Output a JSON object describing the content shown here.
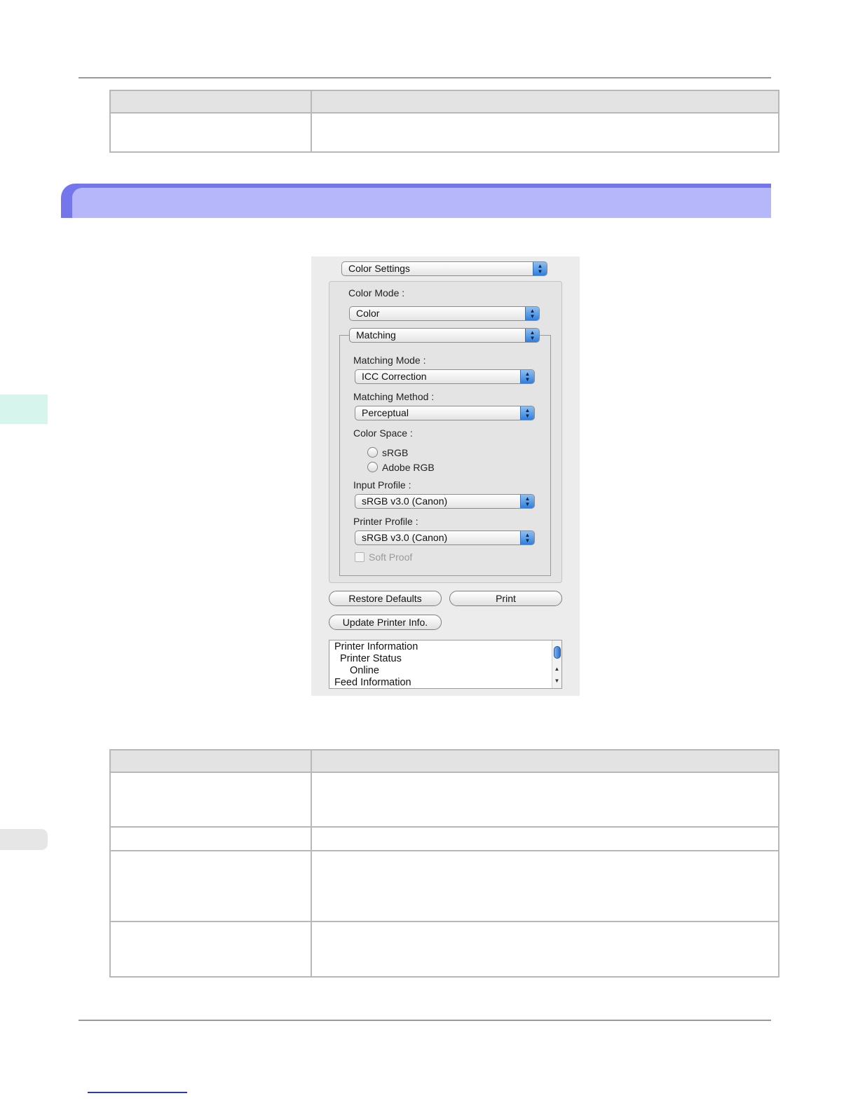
{
  "dialog": {
    "panel_select": "Color Settings",
    "color_mode_label": "Color Mode :",
    "color_mode_value": "Color",
    "matching_select": "Matching",
    "matching_mode_label": "Matching Mode :",
    "matching_mode_value": "ICC Correction",
    "matching_method_label": "Matching Method :",
    "matching_method_value": "Perceptual",
    "color_space_label": "Color Space :",
    "color_space_options": [
      "sRGB",
      "Adobe RGB"
    ],
    "input_profile_label": "Input Profile :",
    "input_profile_value": "sRGB v3.0 (Canon)",
    "printer_profile_label": "Printer Profile :",
    "printer_profile_value": "sRGB v3.0 (Canon)",
    "soft_proof_label": "Soft Proof",
    "restore_defaults": "Restore Defaults",
    "print": "Print",
    "update_printer_info": "Update Printer Info.",
    "info_list": [
      "Printer Information",
      "Printer Status",
      "Online",
      "Feed Information"
    ]
  }
}
